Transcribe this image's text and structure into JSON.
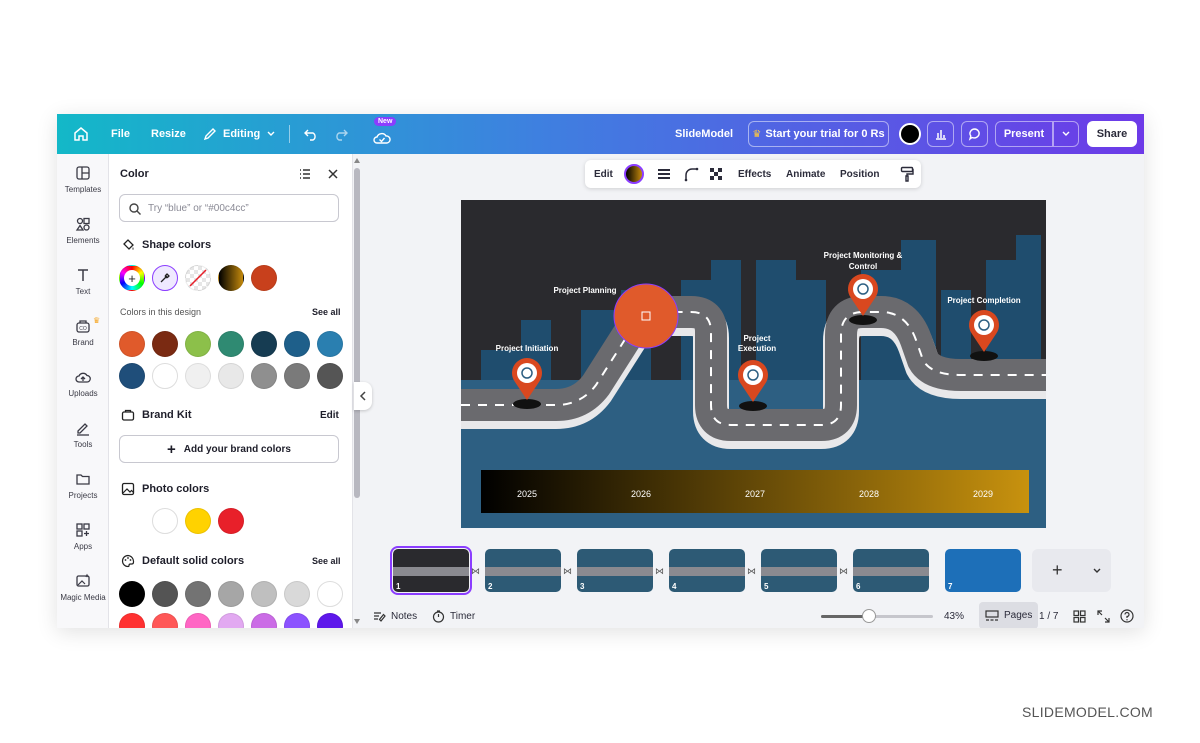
{
  "topbar": {
    "file": "File",
    "resize": "Resize",
    "editing": "Editing",
    "new_badge": "New",
    "doc_title": "SlideModel",
    "trial": "Start your trial for 0 Rs",
    "present": "Present",
    "share": "Share"
  },
  "rail": {
    "items": [
      {
        "label": "Templates"
      },
      {
        "label": "Elements"
      },
      {
        "label": "Text"
      },
      {
        "label": "Brand"
      },
      {
        "label": "Uploads"
      },
      {
        "label": "Tools"
      },
      {
        "label": "Projects"
      },
      {
        "label": "Apps"
      },
      {
        "label": "Magic Media"
      }
    ]
  },
  "panel": {
    "title": "Color",
    "search_placeholder": "Try “blue” or “#00c4cc”",
    "shape_colors": "Shape colors",
    "colors_in_design": "Colors in this design",
    "see_all_1": "See all",
    "brand_kit": "Brand Kit",
    "edit": "Edit",
    "add_brand": "Add your brand colors",
    "photo_colors": "Photo colors",
    "default_solid": "Default solid colors",
    "see_all_2": "See all",
    "design_colors_row1": [
      "#e05a2b",
      "#7a2a12",
      "#8cc04a",
      "#2f8a72",
      "#163c52",
      "#1e5f8a",
      "#2a7fb0"
    ],
    "design_colors_row2": [
      "#1f4e7a",
      "#ffffff",
      "#f0f0f0",
      "#e8e8e8",
      "#8f8f8f",
      "#7a7a7a",
      "#555555"
    ],
    "photo_colors_list": [
      "#ffffff",
      "#ffd200",
      "#e8202a"
    ],
    "default_row1": [
      "#000000",
      "#545454",
      "#737373",
      "#a6a6a6",
      "#bfbfbf",
      "#d9d9d9",
      "#ffffff"
    ],
    "default_row2": [
      "#ff3131",
      "#ff5757",
      "#ff66c4",
      "#e2a9f1",
      "#cb6ce6",
      "#8c52ff",
      "#5e17eb"
    ]
  },
  "toolbar": {
    "edit": "Edit",
    "effects": "Effects",
    "animate": "Animate",
    "position": "Position"
  },
  "slide": {
    "milestones": [
      "Project Initiation",
      "Project Planning",
      "Project Execution",
      "Project Monitoring & Control",
      "Project Completion"
    ],
    "years": [
      "2025",
      "2026",
      "2027",
      "2028",
      "2029"
    ]
  },
  "thumbnails": [
    "1",
    "2",
    "3",
    "4",
    "5",
    "6",
    "7"
  ],
  "bottom": {
    "notes": "Notes",
    "timer": "Timer",
    "zoom": "43%",
    "pages": "Pages",
    "page_count": "1 / 7"
  },
  "watermark": "SLIDEMODEL.COM"
}
